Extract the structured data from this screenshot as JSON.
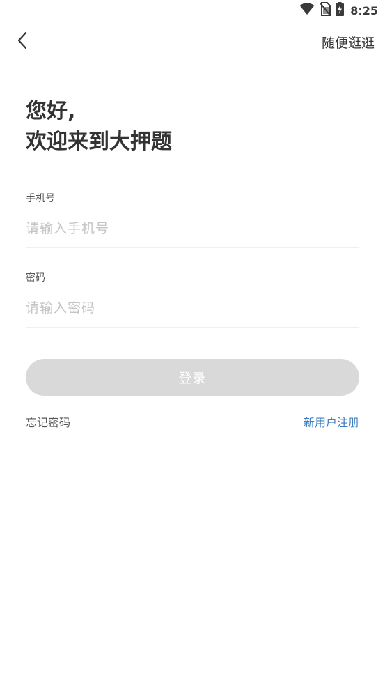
{
  "status_bar": {
    "time": "8:25",
    "icons": [
      "wifi-icon",
      "no-sim-icon",
      "battery-charging-icon"
    ]
  },
  "nav": {
    "back_icon": "chevron-left-icon",
    "browse_label": "随便逛逛"
  },
  "greeting": {
    "line1": "您好,",
    "line2": "欢迎来到大押题"
  },
  "phone_field": {
    "label": "手机号",
    "value": "",
    "placeholder": "请输入手机号"
  },
  "password_field": {
    "label": "密码",
    "value": "",
    "placeholder": "请输入密码"
  },
  "login_button": {
    "label": "登录"
  },
  "links": {
    "forgot_password": "忘记密码",
    "register": "新用户注册"
  },
  "colors": {
    "background": "#ffffff",
    "text_primary": "#333333",
    "placeholder": "#c4c4c4",
    "button_disabled": "#d9d9d9",
    "link_accent": "#3d7fc1"
  }
}
